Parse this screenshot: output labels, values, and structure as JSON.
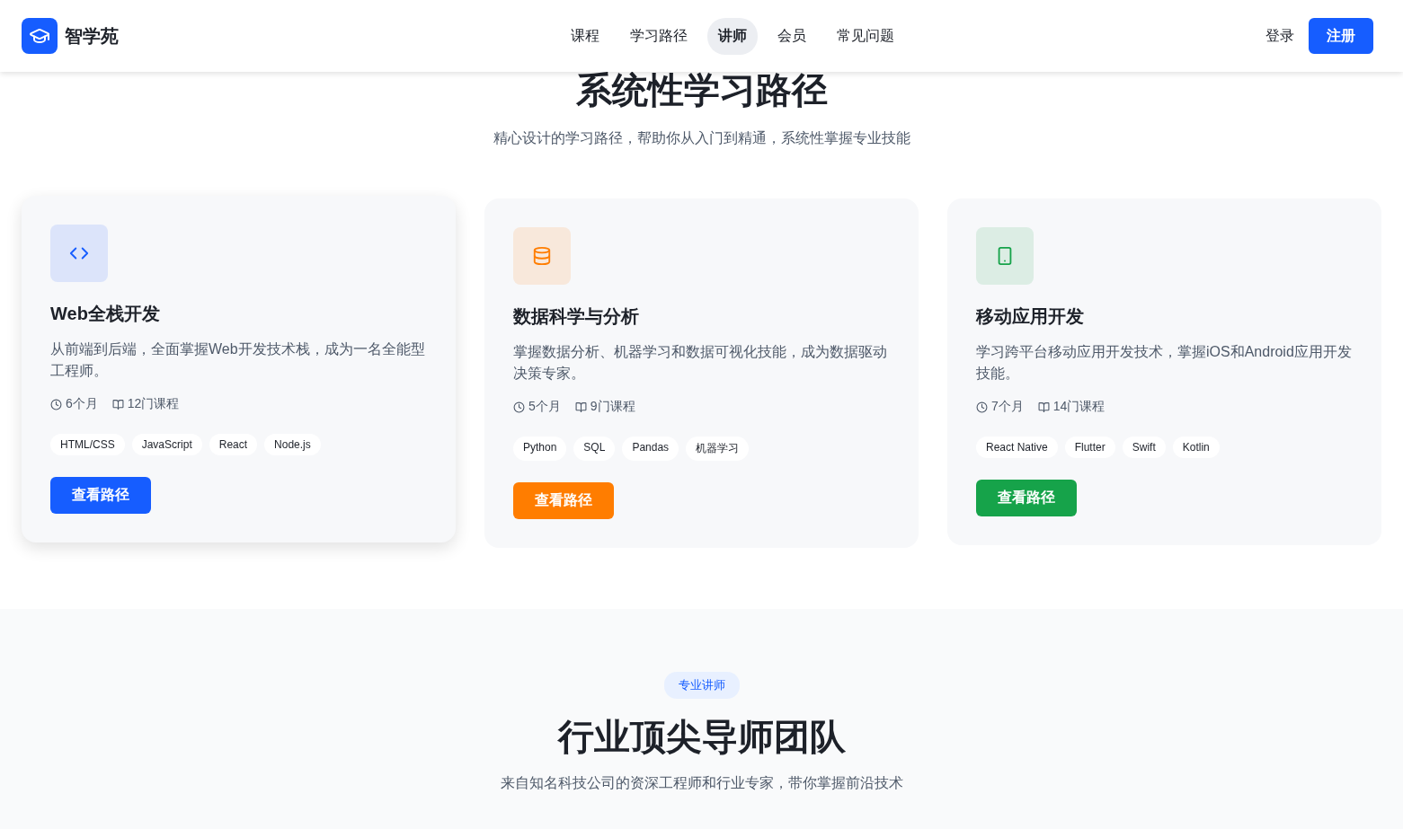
{
  "header": {
    "logo": "智学苑",
    "nav": [
      {
        "label": "课程",
        "selected": false
      },
      {
        "label": "学习路径",
        "selected": false
      },
      {
        "label": "讲师",
        "selected": true
      },
      {
        "label": "会员",
        "selected": false
      },
      {
        "label": "常见问题",
        "selected": false
      }
    ],
    "login": "登录",
    "register": "注册"
  },
  "paths_section": {
    "title": "系统性学习路径",
    "subtitle": "精心设计的学习路径，帮助你从入门到精通，系统性掌握专业技能",
    "cards": [
      {
        "kind": "code",
        "color": "#165dff",
        "raised": true,
        "title": "Web全栈开发",
        "description": "从前端到后端，全面掌握Web开发技术栈，成为一名全能型工程师。",
        "duration": "6个月",
        "courses": "12门课程",
        "tags": [
          "HTML/CSS",
          "JavaScript",
          "React",
          "Node.js"
        ],
        "button": "查看路径"
      },
      {
        "kind": "database",
        "color": "#ff7d00",
        "raised": false,
        "title": "数据科学与分析",
        "description": "掌握数据分析、机器学习和数据可视化技能，成为数据驱动决策专家。",
        "duration": "5个月",
        "courses": "9门课程",
        "tags": [
          "Python",
          "SQL",
          "Pandas",
          "机器学习"
        ],
        "button": "查看路径"
      },
      {
        "kind": "mobile",
        "color": "#16a34a",
        "raised": false,
        "title": "移动应用开发",
        "description": "学习跨平台移动应用开发技术，掌握iOS和Android应用开发技能。",
        "duration": "7个月",
        "courses": "14门课程",
        "tags": [
          "React Native",
          "Flutter",
          "Swift",
          "Kotlin"
        ],
        "button": "查看路径"
      }
    ]
  },
  "mentors_section": {
    "badge": "专业讲师",
    "title": "行业顶尖导师团队",
    "subtitle": "来自知名科技公司的资深工程师和行业专家，带你掌握前沿技术"
  }
}
